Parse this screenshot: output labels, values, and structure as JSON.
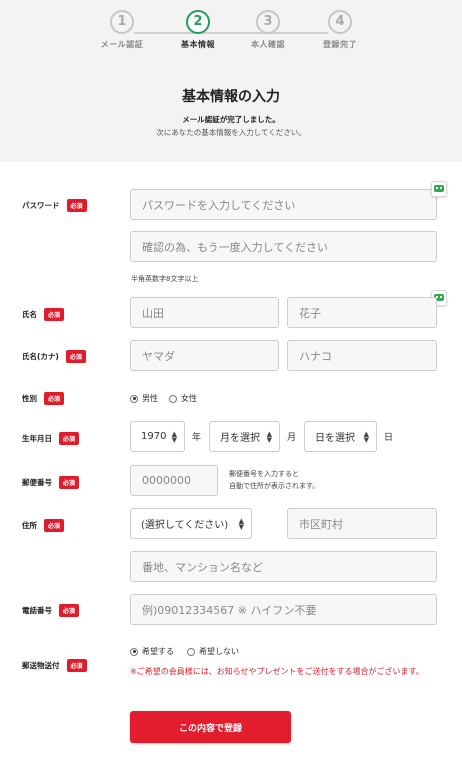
{
  "steps": [
    {
      "num": "1",
      "label": "メール認証"
    },
    {
      "num": "2",
      "label": "基本情報"
    },
    {
      "num": "3",
      "label": "本人確認"
    },
    {
      "num": "4",
      "label": "登録完了"
    }
  ],
  "header": {
    "title": "基本情報の入力",
    "line1": "メール認証が完了しました。",
    "line2": "次にあなたの基本情報を入力してください。"
  },
  "required_badge": "必須",
  "password": {
    "label": "パスワード",
    "placeholder": "パスワードを入力してください",
    "confirm_placeholder": "確認の為、もう一度入力してください",
    "hint": "半角英数字8文字以上"
  },
  "name": {
    "label": "氏名",
    "last": "山田",
    "first": "花子"
  },
  "kana": {
    "label": "氏名(カナ)",
    "last": "ヤマダ",
    "first": "ハナコ"
  },
  "gender": {
    "label": "性別",
    "options": [
      "男性",
      "女性"
    ],
    "selected": "男性"
  },
  "birth": {
    "label": "生年月日",
    "year": "1970",
    "year_unit": "年",
    "month": "月を選択",
    "month_unit": "月",
    "day": "日を選択",
    "day_unit": "日"
  },
  "postal": {
    "label": "郵便番号",
    "placeholder": "0000000",
    "note1": "郵便番号を入力すると",
    "note2": "自動で住所が表示されます。"
  },
  "address": {
    "label": "住所",
    "pref": "(選択してください)",
    "city_placeholder": "市区町村",
    "street_placeholder": "番地、マンション名など"
  },
  "phone": {
    "label": "電話番号",
    "placeholder": "例)09012334567 ※ ハイフン不要"
  },
  "mail": {
    "label": "郵送物送付",
    "options": [
      "希望する",
      "希望しない"
    ],
    "selected": "希望する",
    "warning": "※ご希望の会員様には、お知らせやプレゼントをご送付をする場合がございます。"
  },
  "submit_label": "この内容で登録",
  "colors": {
    "accent": "#21a05a",
    "required": "#e01c2c",
    "submit": "#e31c2e",
    "top_bg": "#f3f3f3"
  },
  "icons": [
    "password-manager-icon"
  ]
}
